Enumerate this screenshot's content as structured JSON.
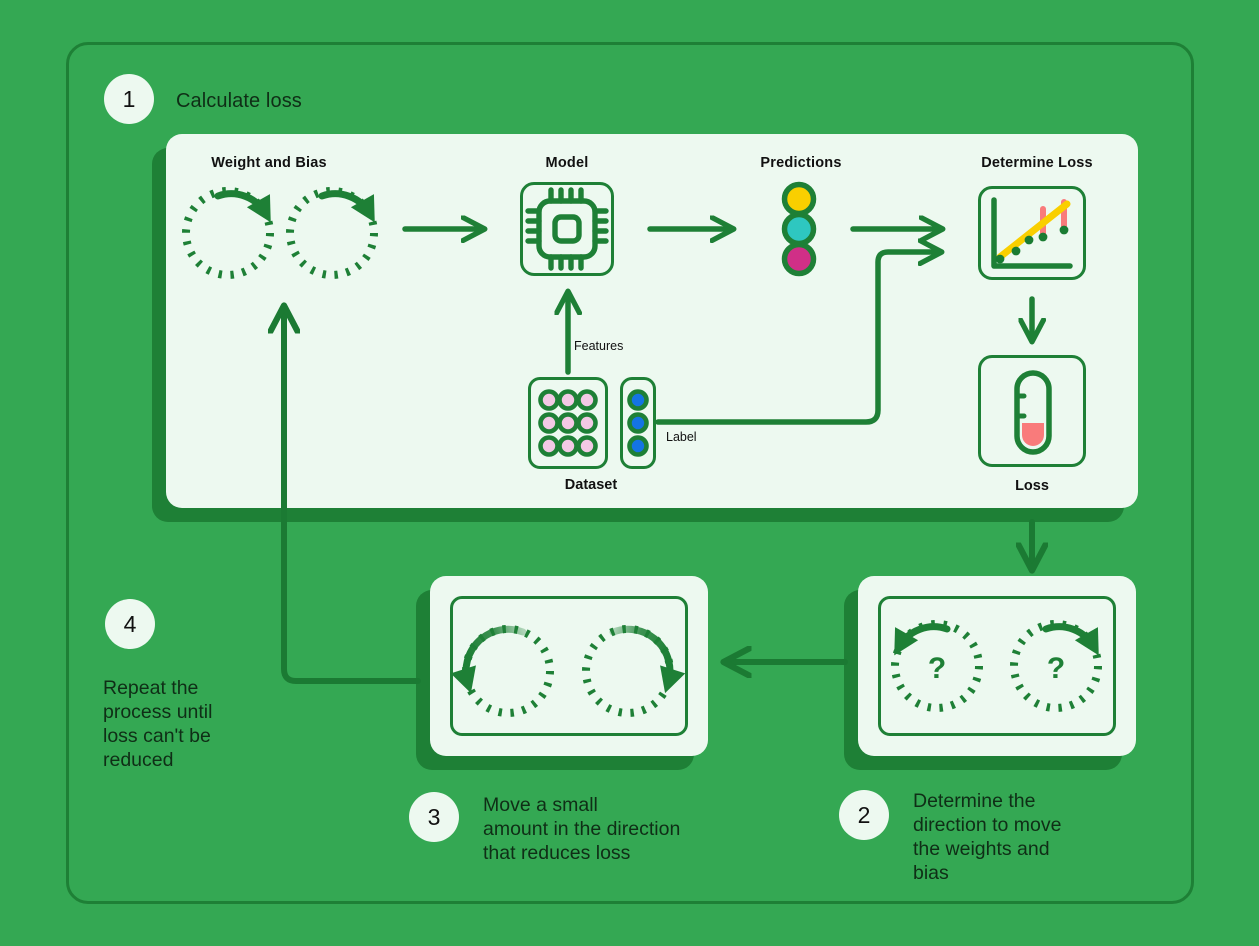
{
  "theme": {
    "bg_green": "#34A853",
    "dark_green": "#1E8036",
    "card_mint": "#EDF9F0",
    "text_dark": "#0F2E16",
    "yellow": "#F9CF00",
    "teal": "#2EC7C0",
    "magenta": "#D02F87",
    "pink_feature": "#F3C9E5",
    "blue_label": "#1474E3",
    "loss_pink": "#F97B7B"
  },
  "steps": [
    {
      "number": "1",
      "title": "Calculate loss",
      "body": ""
    },
    {
      "number": "2",
      "title": "",
      "body": "Determine the\ndirection to move\nthe weights and\nbias"
    },
    {
      "number": "3",
      "title": "",
      "body": "Move a small\namount in the direction\nthat reduces loss"
    },
    {
      "number": "4",
      "title": "",
      "body": "Repeat the\nprocess until\nloss can't be\nreduced"
    }
  ],
  "pipeline": {
    "columns": [
      {
        "title": "Weight and Bias"
      },
      {
        "title": "Model"
      },
      {
        "title": "Predictions"
      },
      {
        "title": "Determine Loss"
      }
    ],
    "dataset_label": "Dataset",
    "features_label": "Features",
    "label_label": "Label",
    "loss_label": "Loss"
  },
  "chart_data": {
    "type": "scatter",
    "title": "Determine Loss",
    "x": [
      1,
      2,
      3,
      4,
      5
    ],
    "y": [
      0.6,
      1.4,
      2.2,
      3.2,
      3.9
    ],
    "fit_line": {
      "from": [
        0.6,
        0.5
      ],
      "to": [
        5.2,
        4.6
      ]
    },
    "residuals": [
      0.0,
      0.1,
      0.15,
      0.5,
      0.75
    ],
    "xlabel": "",
    "ylabel": "",
    "grid": false,
    "legend": "none"
  },
  "predictions": {
    "dots": [
      {
        "name": "prediction-dot-1",
        "color": "#F9CF00"
      },
      {
        "name": "prediction-dot-2",
        "color": "#2EC7C0"
      },
      {
        "name": "prediction-dot-3",
        "color": "#D02F87"
      }
    ]
  },
  "dataset": {
    "feature_rows": 3,
    "feature_cols": 3,
    "feature_color": "#F3C9E5",
    "label_count": 3,
    "label_color": "#1474E3"
  },
  "loss_gauge": {
    "fill_ratio": 0.32,
    "fill_color": "#F97B7B"
  },
  "weight_bias_dials": {
    "step1": [
      {
        "name": "weight-dial",
        "marks": 24,
        "arrow": "clockwise-short"
      },
      {
        "name": "bias-dial",
        "marks": 24,
        "arrow": "clockwise-short"
      }
    ],
    "step2": [
      {
        "name": "weight-dial-question",
        "glyph": "?",
        "arrow": "counter-clockwise"
      },
      {
        "name": "bias-dial-question",
        "glyph": "?",
        "arrow": "clockwise"
      }
    ],
    "step3": [
      {
        "name": "weight-dial-move",
        "arrow": "counter-clockwise-long"
      },
      {
        "name": "bias-dial-move",
        "arrow": "clockwise-long"
      }
    ]
  }
}
